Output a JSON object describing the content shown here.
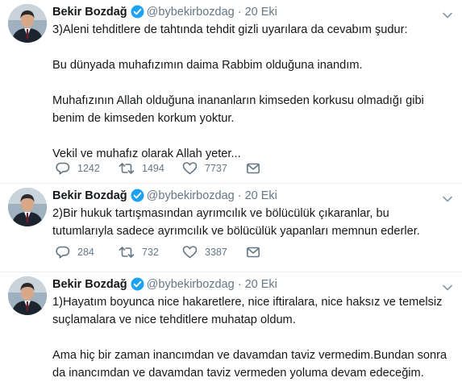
{
  "timeline": {
    "tweets": [
      {
        "author_name": "Bekir Bozdağ",
        "author_handle": "@bybekirbozdag",
        "separator": "·",
        "date": "20 Eki",
        "paragraphs": [
          "3)Aleni tehditlere de tahtında tehdit gizli uyarılara da cevabım şudur:",
          "Bu dünyada muhafızımın daima Rabbim olduğuna inandım.",
          "Muhafızının Allah olduğuna inananların kimseden korkusu olmadığı gibi benim de kimseden korkum yoktur.",
          "Vekil ve muhafız olarak Allah yeter..."
        ],
        "replies": "1242",
        "retweets": "1494",
        "likes": "7737"
      },
      {
        "author_name": "Bekir Bozdağ",
        "author_handle": "@bybekirbozdag",
        "separator": "·",
        "date": "20 Eki",
        "paragraphs": [
          "2)Bir hukuk tartışmasından ayrımcılık ve bölücülük çıkaranlar, bu tutumlarıyla sadece ayrımcılık ve bölücülük yapanları memnun ederler."
        ],
        "replies": "284",
        "retweets": "732",
        "likes": "3387"
      },
      {
        "author_name": "Bekir Bozdağ",
        "author_handle": "@bybekirbozdag",
        "separator": "·",
        "date": "20 Eki",
        "paragraphs": [
          "1)Hayatım boyunca nice hakaretlere, nice iftiralara, nice haksız ve temelsiz suçlamalara ve nice tehditlere muhatap oldum.",
          "Ama hiç bir zaman inancımdan ve davamdan taviz vermedim.Bundan sonra da inancımdan ve davamdan taviz vermeden yoluma devam edeceğim."
        ]
      }
    ]
  },
  "icons": {
    "verified": "verified-badge-icon",
    "caret": "chevron-down-icon",
    "reply": "reply-icon",
    "retweet": "retweet-icon",
    "like": "heart-icon",
    "dm": "envelope-icon"
  },
  "colors": {
    "text": "#14171a",
    "secondary": "#657786",
    "verified": "#1da1f2",
    "divider": "#e6ecf0"
  }
}
